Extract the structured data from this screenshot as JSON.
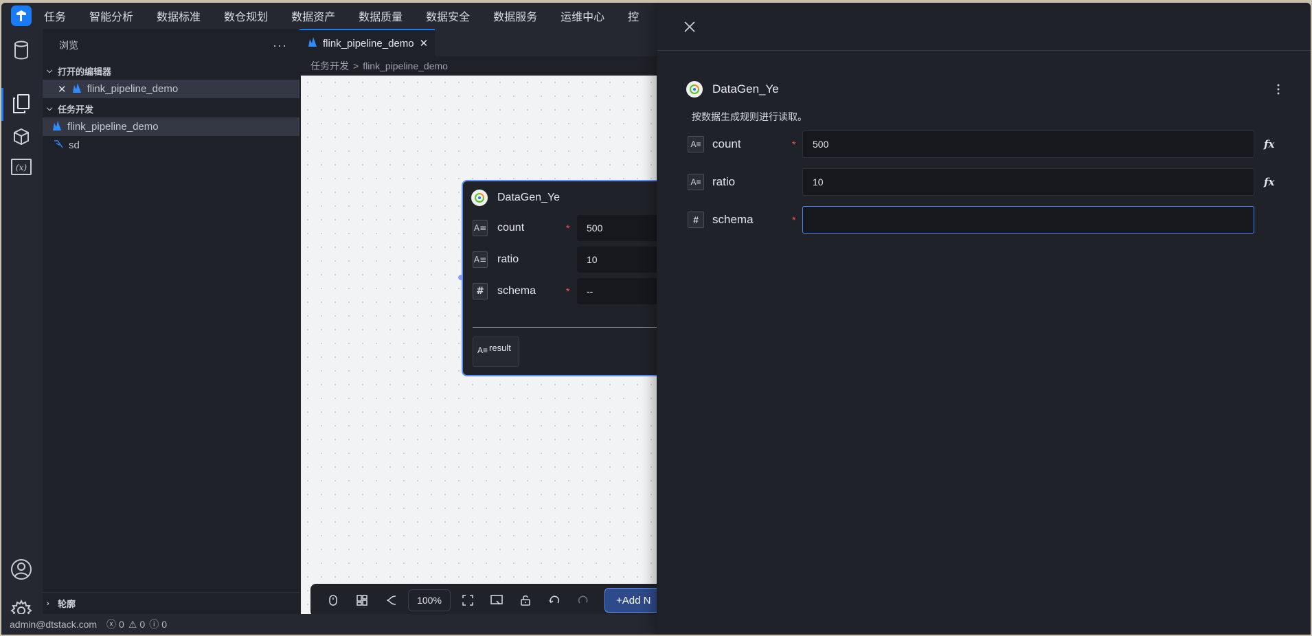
{
  "nav": {
    "items": [
      "任务",
      "智能分析",
      "数据标准",
      "数仓规划",
      "数据资产",
      "数据质量",
      "数据安全",
      "数据服务",
      "运维中心",
      "控"
    ]
  },
  "sidebar": {
    "title": "浏览",
    "more": "···",
    "open_editors_label": "打开的编辑器",
    "open_editor_item": "flink_pipeline_demo",
    "task_dev_label": "任务开发",
    "task_items": [
      "flink_pipeline_demo",
      "sd"
    ],
    "outline_label": "轮廓"
  },
  "editor": {
    "tab_label": "flink_pipeline_demo",
    "breadcrumb_root": "任务开发",
    "breadcrumb_sep": ">",
    "breadcrumb_leaf": "flink_pipeline_demo",
    "node": {
      "title": "DataGen_Ye",
      "fields": [
        {
          "name": "count",
          "value": "500",
          "required": "*",
          "type": "A≡"
        },
        {
          "name": "ratio",
          "value": "10",
          "required": "",
          "type": "A≡"
        },
        {
          "name": "schema",
          "value": "--",
          "required": "*",
          "type": "#"
        }
      ],
      "output": "result",
      "output_type": "A≡"
    },
    "toolbar": {
      "zoom": "100%",
      "add_label": "+Add N"
    }
  },
  "statusbar": {
    "user": "admin@dtstack.com",
    "errors": "0",
    "warnings": "0",
    "infos": "0"
  },
  "drawer": {
    "title": "DataGen_Ye",
    "description": "按数据生成规则进行读取。",
    "fields": [
      {
        "name": "count",
        "value": "500",
        "required": "*",
        "type": "A≡"
      },
      {
        "name": "ratio",
        "value": "10",
        "required": "",
        "type": "A≡"
      },
      {
        "name": "schema",
        "value": "",
        "required": "*",
        "type": "#"
      }
    ],
    "fx_label": "fx"
  },
  "colors": {
    "accent": "#1a7cf5",
    "node_border": "#5b8ff9",
    "required": "#ff4d4f"
  }
}
